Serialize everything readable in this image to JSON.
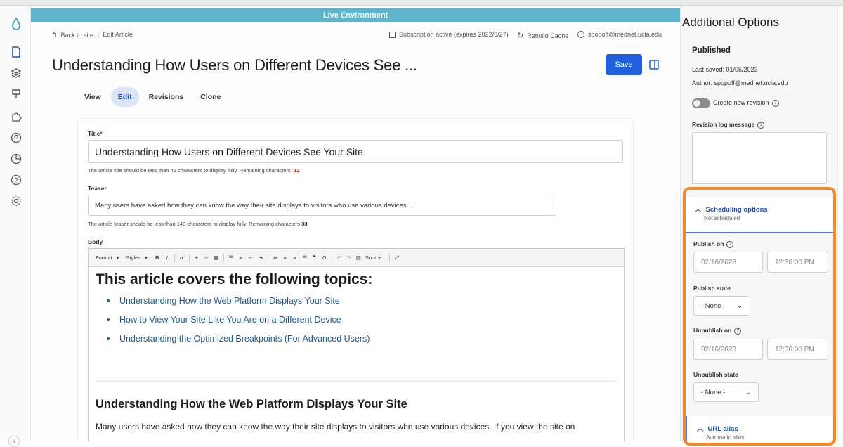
{
  "environment_banner": "Live Environment",
  "topbar": {
    "back_label": "Back to site",
    "breadcrumb_current": "Edit Article",
    "subscription": "Subscription active (expires 2022/6/27)",
    "rebuild_cache": "Rebuild Cache",
    "user_email": "spopoff@mednet.ucla.edu"
  },
  "page_title": "Understanding How Users on Different Devices See ...",
  "save_label": "Save",
  "tabs": [
    {
      "label": "View",
      "active": false
    },
    {
      "label": "Edit",
      "active": true
    },
    {
      "label": "Revisions",
      "active": false
    },
    {
      "label": "Clone",
      "active": false
    }
  ],
  "form": {
    "title_label": "Title",
    "title_required_mark": "*",
    "title_value": "Understanding How Users on Different Devices See Your Site",
    "title_help": "The article title should be less than 46 characters to display fully. Remaining characters",
    "title_remaining": "-12",
    "teaser_label": "Teaser",
    "teaser_value": "Many users have asked how they can know the way their site displays to visitors who use various devices....",
    "teaser_help": "The article teaser should be less than 140 characters to display fully. Remaining characters",
    "teaser_remaining": "33",
    "body_label": "Body"
  },
  "editor": {
    "format_label": "Format",
    "styles_label": "Styles",
    "source_label": "Source",
    "heading": "This article covers the following topics:",
    "topics": [
      "Understanding How the Web Platform Displays Your Site",
      "How to View Your Site Like You Are on a Different Device",
      "Understanding the Optimized Breakpoints (For Advanced Users)"
    ],
    "section_heading": "Understanding How the Web Platform Displays Your Site",
    "paragraph_start": "Many users have asked how they can know the way their site displays to visitors who use various devices. If you view the site on"
  },
  "sidebar": {
    "title": "Additional Options",
    "status": "Published",
    "last_saved": "Last saved: 01/05/2023",
    "author": "Author: spopoff@mednet.ucla.edu",
    "create_revision_label": "Create new revision",
    "revision_log_label": "Revision log message",
    "scheduling_title": "Scheduling options",
    "scheduling_status": "Not scheduled",
    "publish_on_label": "Publish on",
    "publish_date": "02/16/2023",
    "publish_time": "12:30:00 PM",
    "publish_state_label": "Publish state",
    "publish_state_value": "- None -",
    "unpublish_on_label": "Unpublish on",
    "unpublish_date": "02/16/2023",
    "unpublish_time": "12:30:00 PM",
    "unpublish_state_label": "Unpublish state",
    "unpublish_state_value": "- None -",
    "url_alias_title": "URL alias",
    "url_alias_status": "Automatic alias"
  },
  "colors": {
    "brand": "#5bb4c9",
    "primary_button": "#1f5fdc",
    "link": "#1d5a96",
    "highlight_outline": "#f08a2c"
  }
}
